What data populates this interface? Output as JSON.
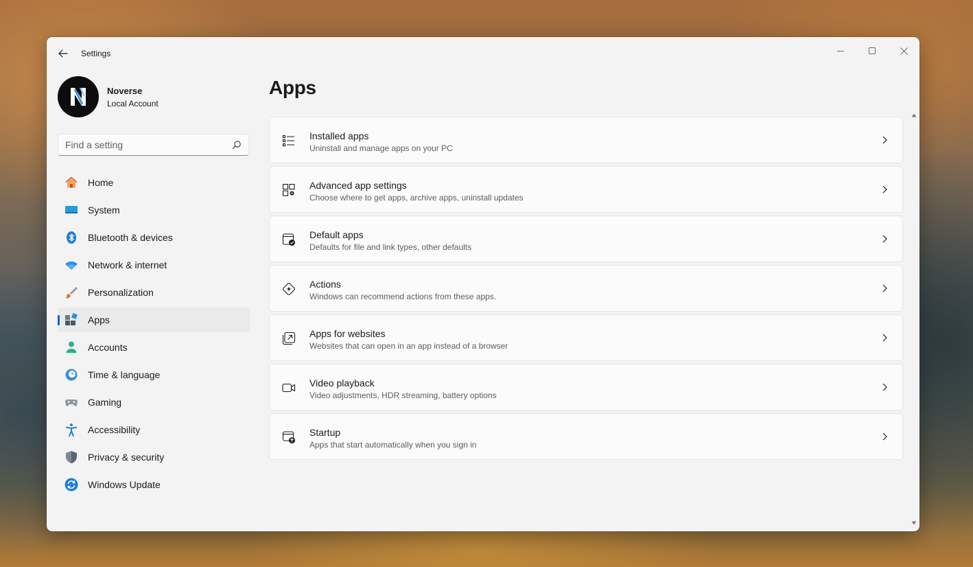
{
  "window": {
    "title": "Settings"
  },
  "profile": {
    "name": "Noverse",
    "account_type": "Local Account"
  },
  "search": {
    "placeholder": "Find a setting"
  },
  "nav": {
    "items": [
      {
        "label": "Home",
        "icon": "home-icon"
      },
      {
        "label": "System",
        "icon": "system-icon"
      },
      {
        "label": "Bluetooth & devices",
        "icon": "bluetooth-icon"
      },
      {
        "label": "Network & internet",
        "icon": "wifi-icon"
      },
      {
        "label": "Personalization",
        "icon": "brush-icon"
      },
      {
        "label": "Apps",
        "icon": "apps-icon",
        "active": true
      },
      {
        "label": "Accounts",
        "icon": "person-icon"
      },
      {
        "label": "Time & language",
        "icon": "clock-globe-icon"
      },
      {
        "label": "Gaming",
        "icon": "gamepad-icon"
      },
      {
        "label": "Accessibility",
        "icon": "accessibility-icon"
      },
      {
        "label": "Privacy & security",
        "icon": "shield-icon"
      },
      {
        "label": "Windows Update",
        "icon": "update-icon"
      }
    ]
  },
  "main": {
    "title": "Apps",
    "cards": [
      {
        "title": "Installed apps",
        "description": "Uninstall and manage apps on your PC",
        "icon": "list-icon"
      },
      {
        "title": "Advanced app settings",
        "description": "Choose where to get apps, archive apps, uninstall updates",
        "icon": "app-settings-icon"
      },
      {
        "title": "Default apps",
        "description": "Defaults for file and link types, other defaults",
        "icon": "default-apps-icon"
      },
      {
        "title": "Actions",
        "description": "Windows can recommend actions from these apps.",
        "icon": "actions-icon"
      },
      {
        "title": "Apps for websites",
        "description": "Websites that can open in an app instead of a browser",
        "icon": "open-external-icon"
      },
      {
        "title": "Video playback",
        "description": "Video adjustments, HDR streaming, battery options",
        "icon": "video-icon"
      },
      {
        "title": "Startup",
        "description": "Apps that start automatically when you sign in",
        "icon": "startup-icon"
      }
    ]
  },
  "colors": {
    "accent": "#0067c0",
    "window_bg": "#f3f3f3",
    "card_bg": "#fbfbfb"
  }
}
